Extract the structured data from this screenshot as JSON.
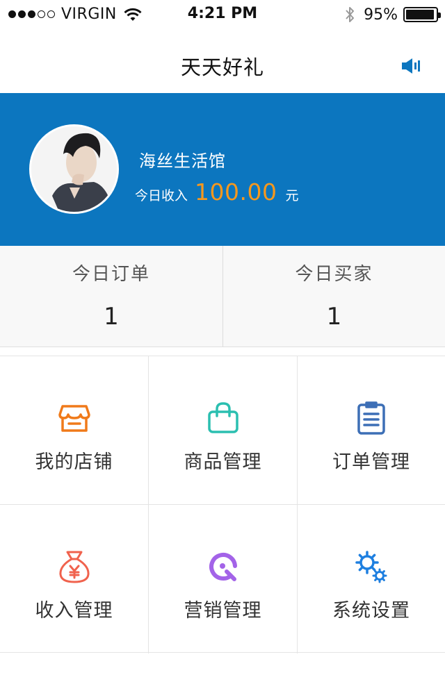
{
  "status_bar": {
    "carrier": "VIRGIN",
    "time": "4:21 PM",
    "battery_percent": "95%",
    "battery_level": 0.95,
    "signal_bars_filled": 3,
    "signal_bars_total": 5
  },
  "nav": {
    "title": "天天好礼",
    "speaker_icon": "speaker-icon"
  },
  "profile": {
    "shop_name": "海丝生活馆",
    "income_label": "今日收入",
    "income_value": "100.00",
    "income_unit": "元",
    "banner_color": "#0c76bf",
    "income_color": "#f7981d"
  },
  "stats": [
    {
      "label": "今日订单",
      "value": "1"
    },
    {
      "label": "今日买家",
      "value": "1"
    }
  ],
  "menu": [
    {
      "label": "我的店铺",
      "icon": "store-icon",
      "color": "#f07a1a"
    },
    {
      "label": "商品管理",
      "icon": "shopping-bag-icon",
      "color": "#2bbfb0"
    },
    {
      "label": "订单管理",
      "icon": "clipboard-list-icon",
      "color": "#3d6fb6"
    },
    {
      "label": "收入管理",
      "icon": "money-bag-icon",
      "color": "#f0624d"
    },
    {
      "label": "营销管理",
      "icon": "marketing-icon",
      "color": "#a363e8"
    },
    {
      "label": "系统设置",
      "icon": "gears-icon",
      "color": "#1e7fe0"
    }
  ]
}
